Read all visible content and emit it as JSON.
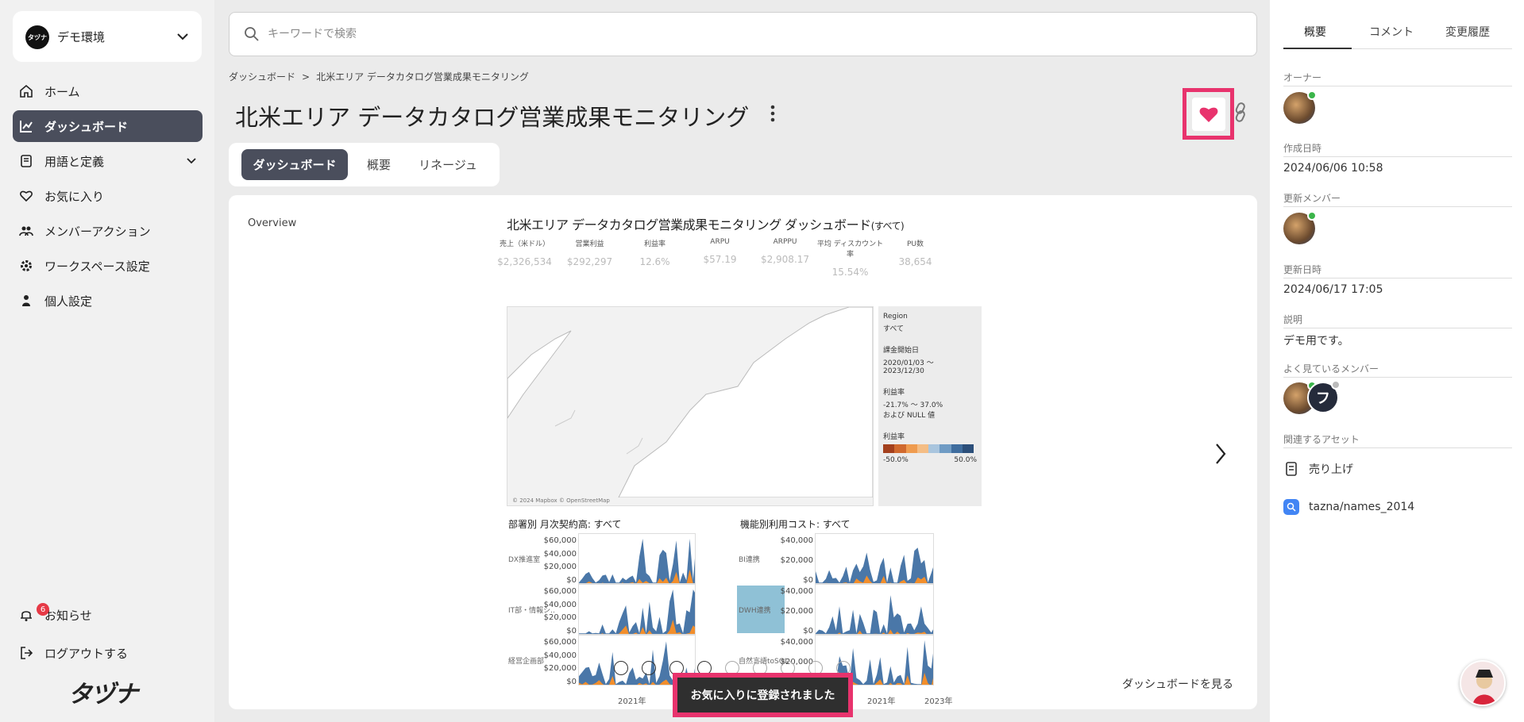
{
  "workspace": {
    "name": "デモ環境",
    "logo_text": "タヅナ"
  },
  "nav": [
    {
      "label": "ホーム",
      "icon": "home-icon"
    },
    {
      "label": "ダッシュボード",
      "icon": "chart-icon",
      "active": true
    },
    {
      "label": "用語と定義",
      "icon": "book-icon"
    },
    {
      "label": "お気に入り",
      "icon": "heart-icon"
    },
    {
      "label": "メンバーアクション",
      "icon": "members-icon"
    },
    {
      "label": "ワークスペース設定",
      "icon": "gear-icon"
    },
    {
      "label": "個人設定",
      "icon": "person-icon"
    }
  ],
  "notifications": {
    "label": "お知らせ",
    "count": "6"
  },
  "logout": {
    "label": "ログアウトする"
  },
  "brand": "タヅナ",
  "search": {
    "placeholder": "キーワードで検索"
  },
  "breadcrumb": {
    "root": "ダッシュボード",
    "sep": ">",
    "current": "北米エリア データカタログ営業成果モニタリング"
  },
  "page": {
    "title": "北米エリア データカタログ営業成果モニタリング"
  },
  "tabs": [
    "ダッシュボード",
    "概要",
    "リネージュ"
  ],
  "preview": {
    "label": "Overview",
    "dash_title": "北米エリア データカタログ営業成果モニタリング ダッシュボード",
    "dash_title_suffix": "(すべて)",
    "kpis": [
      {
        "label": "売上（米ドル）",
        "value": "$2,326,534"
      },
      {
        "label": "営業利益",
        "value": "$292,297"
      },
      {
        "label": "利益率",
        "value": "12.6%"
      },
      {
        "label": "ARPU",
        "value": "$57.19"
      },
      {
        "label": "ARPPU",
        "value": "$2,908.17"
      },
      {
        "label": "平均 ディスカウント率",
        "value": "15.54%"
      },
      {
        "label": "PU数",
        "value": "38,654"
      }
    ],
    "map_credit": "© 2024 Mapbox © OpenStreetMap",
    "filters": {
      "region_label": "Region",
      "region_value": "すべて",
      "date_label": "課金開始日",
      "date_value": "2020/01/03 〜 2023/12/30",
      "margin_label": "利益率",
      "margin_value": "-21.7% 〜 37.0%",
      "margin_null": "および NULL 値",
      "legend_label": "利益率",
      "legend_min": "-50.0%",
      "legend_max": "50.0%",
      "legend_colors": [
        "#a3401d",
        "#d0692e",
        "#ef9b4f",
        "#f4bd85",
        "#a9c5de",
        "#6f9bc4",
        "#3f6d9e",
        "#2c4f7a"
      ]
    },
    "left_chart": {
      "title": "部署別 月次契約高: すべて",
      "rows": [
        "DX推進室",
        "IT部・情報シ..",
        "経営企画部"
      ],
      "ticks": [
        "$60,000",
        "$40,000",
        "$20,000",
        "$0"
      ],
      "xticks": [
        "2021年"
      ]
    },
    "right_chart": {
      "title": "機能別利用コスト: すべて",
      "rows": [
        "BI連携",
        "DWH連携",
        "自然言語toSQL"
      ],
      "ticks": [
        "$40,000",
        "$20,000",
        "$0"
      ],
      "xticks": [
        "2021年",
        "2023年"
      ]
    },
    "see_dashboard": "ダッシュボードを見る"
  },
  "toast": "お気に入りに登録されました",
  "right_panel": {
    "tabs": [
      "概要",
      "コメント",
      "変更履歴"
    ],
    "owner_label": "オーナー",
    "created_label": "作成日時",
    "created_value": "2024/06/06 10:58",
    "updater_label": "更新メンバー",
    "updated_label": "更新日時",
    "updated_value": "2024/06/17 17:05",
    "desc_label": "説明",
    "desc_value": "デモ用です。",
    "viewers_label": "よく見ているメンバー",
    "viewer_initial": "フ",
    "assets_label": "関連するアセット",
    "assets": [
      {
        "name": "売り上げ",
        "icon": "book-icon"
      },
      {
        "name": "tazna/names_2014",
        "icon": "bigquery-icon"
      }
    ]
  },
  "colors": {
    "accent": "#e8336d",
    "nav_active": "#4a4e5c",
    "series_blue": "#4a77a8",
    "series_orange": "#f28e2b"
  }
}
